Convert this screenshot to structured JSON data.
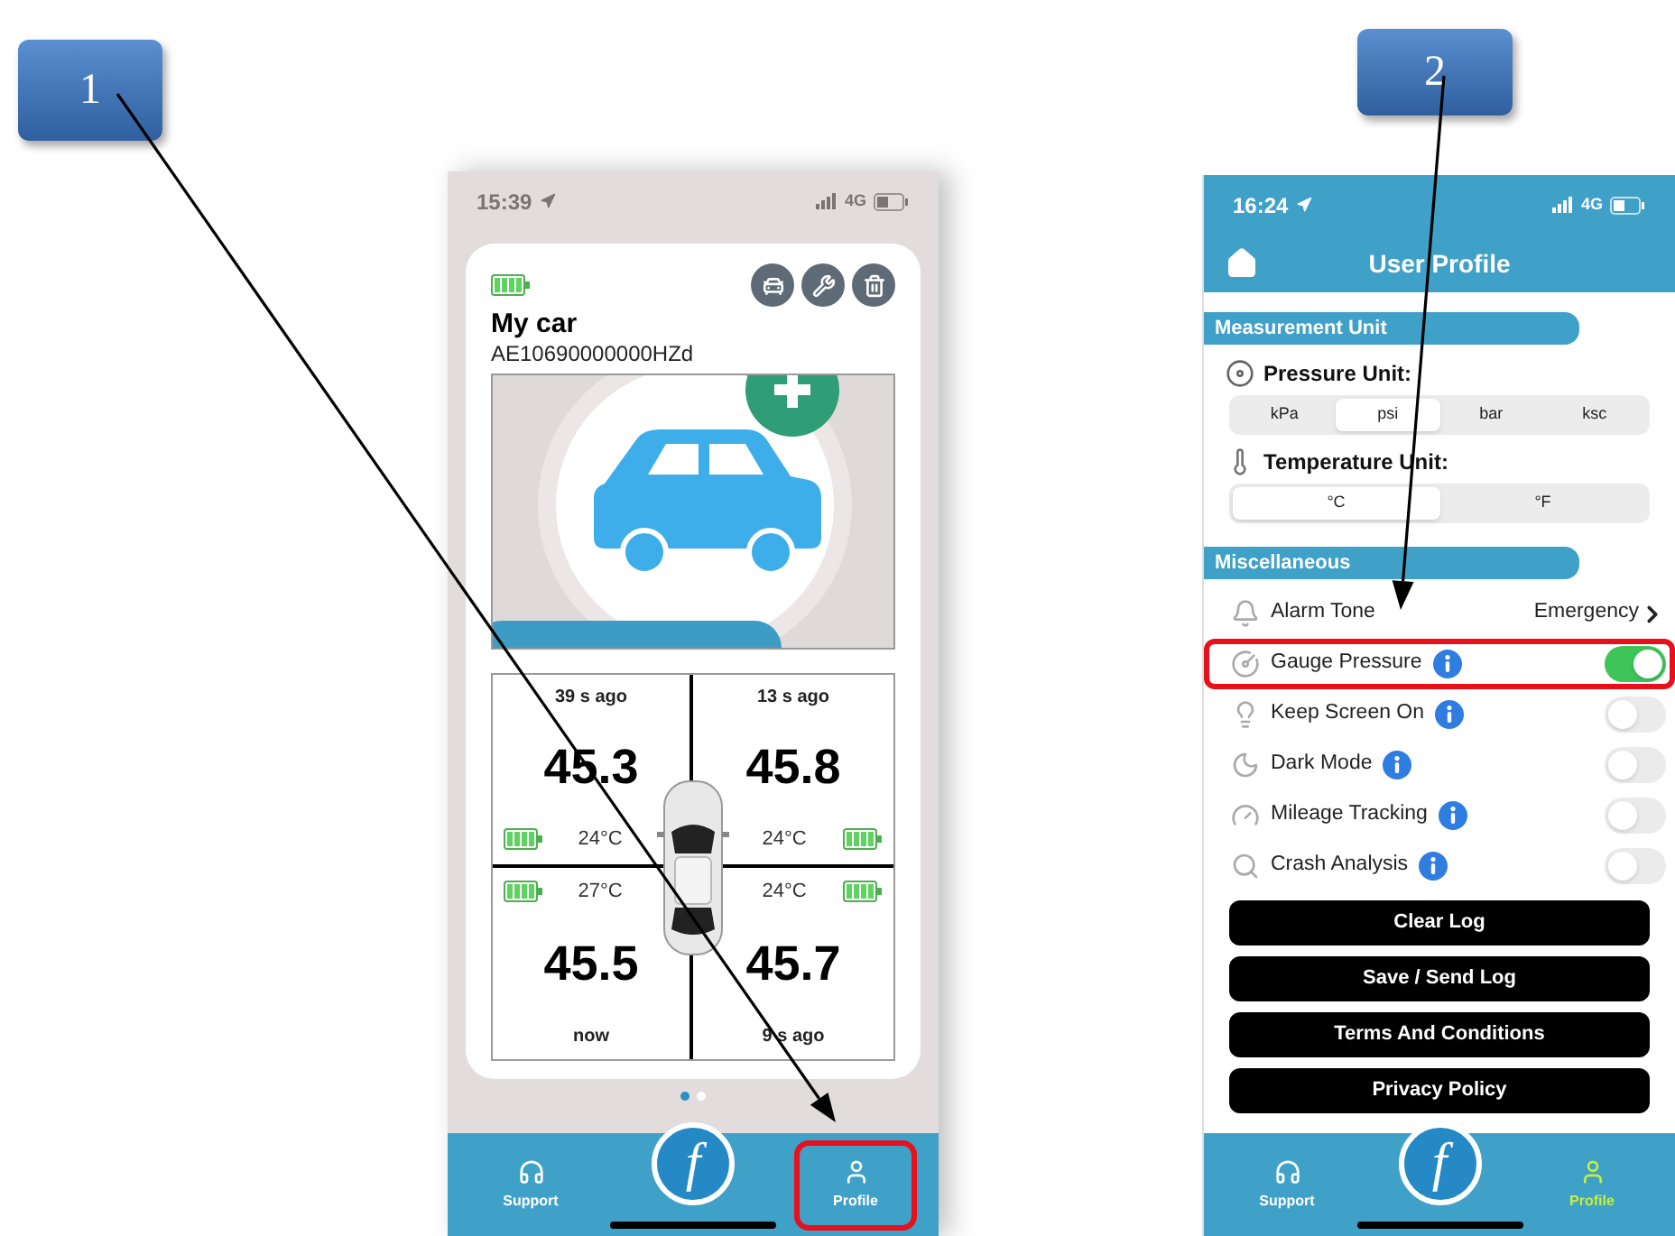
{
  "callouts": [
    {
      "label": "1"
    },
    {
      "label": "2"
    }
  ],
  "home_screen": {
    "status_bar": {
      "time": "15:39",
      "network": "4G"
    },
    "car": {
      "name": "My car",
      "id": "AE10690000000HZd"
    },
    "tires": [
      {
        "updated": "39 s ago",
        "pressure": "45.3",
        "temperature": "24°C"
      },
      {
        "updated": "13 s ago",
        "pressure": "45.8",
        "temperature": "24°C"
      },
      {
        "updated": "now",
        "pressure": "45.5",
        "temperature": "27°C"
      },
      {
        "updated": "9 s ago",
        "pressure": "45.7",
        "temperature": "24°C"
      }
    ],
    "page_dots": [
      {
        "selected": true
      },
      {
        "selected": false
      }
    ],
    "tab_bar": {
      "logo": "f",
      "items": [
        {
          "label": "Support",
          "selected": false,
          "highlighted": false
        },
        {
          "label": "Profile",
          "selected": false,
          "highlighted": true
        }
      ]
    }
  },
  "profile_screen": {
    "status_bar": {
      "time": "16:24",
      "network": "4G"
    },
    "title": "User Profile",
    "measurement": {
      "title": "Measurement Unit",
      "pressure_unit": {
        "label": "Pressure Unit:",
        "options": [
          {
            "label": "kPa",
            "selected": false
          },
          {
            "label": "psi",
            "selected": true
          },
          {
            "label": "bar",
            "selected": false
          },
          {
            "label": "ksc",
            "selected": false
          }
        ]
      },
      "temperature_unit": {
        "label": "Temperature Unit:",
        "options": [
          {
            "label": "°C",
            "selected": true
          },
          {
            "label": "°F",
            "selected": false
          }
        ]
      }
    },
    "misc": {
      "title": "Miscellaneous",
      "rows": [
        {
          "kind": "link",
          "label": "Alarm Tone",
          "value": "Emergency",
          "highlighted": false
        },
        {
          "kind": "toggle",
          "label": "Gauge Pressure",
          "on": true,
          "highlighted": true
        },
        {
          "kind": "toggle",
          "label": "Keep Screen On",
          "on": false,
          "highlighted": false
        },
        {
          "kind": "toggle",
          "label": "Dark Mode",
          "on": false,
          "highlighted": false
        },
        {
          "kind": "toggle",
          "label": "Mileage Tracking",
          "on": false,
          "highlighted": false
        },
        {
          "kind": "toggle",
          "label": "Crash Analysis",
          "on": false,
          "highlighted": false
        }
      ]
    },
    "buttons": [
      "Clear Log",
      "Save / Send Log",
      "Terms And Conditions",
      "Privacy Policy"
    ],
    "tab_bar": {
      "logo": "f",
      "items": [
        {
          "label": "Support",
          "selected": false,
          "highlighted": false
        },
        {
          "label": "Profile",
          "selected": true,
          "highlighted": false
        }
      ]
    }
  }
}
